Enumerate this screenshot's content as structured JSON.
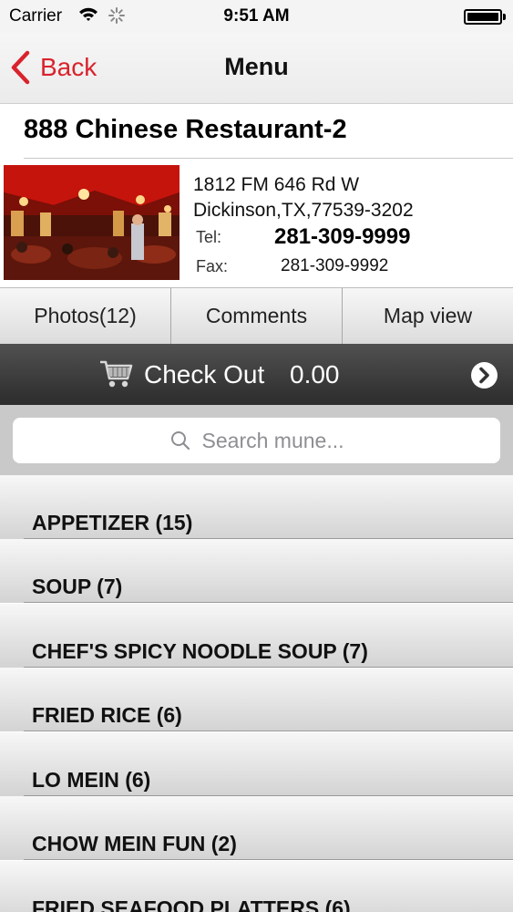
{
  "status_bar": {
    "carrier": "Carrier",
    "time": "9:51 AM"
  },
  "nav": {
    "back_label": "Back",
    "title": "Menu"
  },
  "restaurant": {
    "name": "888 Chinese Restaurant-2",
    "address_line1": "1812 FM 646 Rd W",
    "address_line2": "Dickinson,TX,77539-3202",
    "tel_label": "Tel:",
    "tel": "281-309-9999",
    "fax_label": "Fax:",
    "fax": "281-309-9992"
  },
  "tabs": [
    {
      "label": "Photos(12)"
    },
    {
      "label": "Comments"
    },
    {
      "label": "Map view"
    }
  ],
  "checkout": {
    "label": "Check Out",
    "total": "0.00"
  },
  "search": {
    "placeholder": "Search mune..."
  },
  "menu": [
    {
      "label": "APPETIZER (15)"
    },
    {
      "label": "SOUP (7)"
    },
    {
      "label": "CHEF'S SPICY NOODLE SOUP (7)"
    },
    {
      "label": "FRIED RICE (6)"
    },
    {
      "label": "LO MEIN (6)"
    },
    {
      "label": "CHOW MEIN FUN (2)"
    },
    {
      "label": "FRIED SEAFOOD PLATTERS (6)"
    }
  ],
  "colors": {
    "accent": "#d9232d",
    "checkout_bg": "#3a3a3a"
  },
  "icons": [
    "wifi-icon",
    "activity-spinner-icon",
    "battery-icon",
    "back-chevron-icon",
    "shopping-cart-icon",
    "chevron-right-circle-icon",
    "search-icon"
  ]
}
